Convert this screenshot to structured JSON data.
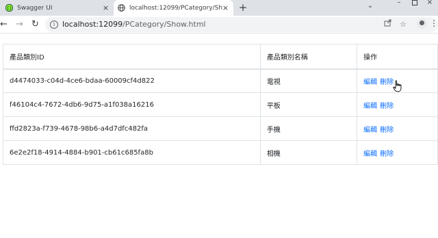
{
  "browser": {
    "tabs": [
      {
        "title": "Swagger UI",
        "icon": "swagger-icon",
        "active": false
      },
      {
        "title": "localhost:12099/PCategory/Sh",
        "icon": "globe-icon",
        "active": true
      }
    ],
    "new_tab_label": "+",
    "url_host": "localhost:12099",
    "url_path": "/PCategory/Show.html"
  },
  "table": {
    "headers": [
      "產品類別ID",
      "產品類別名稱",
      "操作"
    ],
    "rows": [
      {
        "id": "d4474033-c04d-4ce6-bdaa-60009cf4d822",
        "name": "電視",
        "edit": "編輯",
        "delete": "刪除"
      },
      {
        "id": "f46104c4-7672-4db6-9d75-a1f038a16216",
        "name": "平板",
        "edit": "編輯",
        "delete": "刪除"
      },
      {
        "id": "ffd2823a-f739-4678-98b6-a4d7dfc482fa",
        "name": "手機",
        "edit": "編輯",
        "delete": "刪除"
      },
      {
        "id": "6e2e2f18-4914-4884-b901-cb61c685fa8b",
        "name": "相機",
        "edit": "編輯",
        "delete": "刪除"
      }
    ]
  },
  "colors": {
    "link": "#0d6efd",
    "border": "#dee2e6",
    "tabstrip": "#dee1e6",
    "omnibox": "#f1f3f4",
    "swagger_green": "#85ea2d"
  }
}
